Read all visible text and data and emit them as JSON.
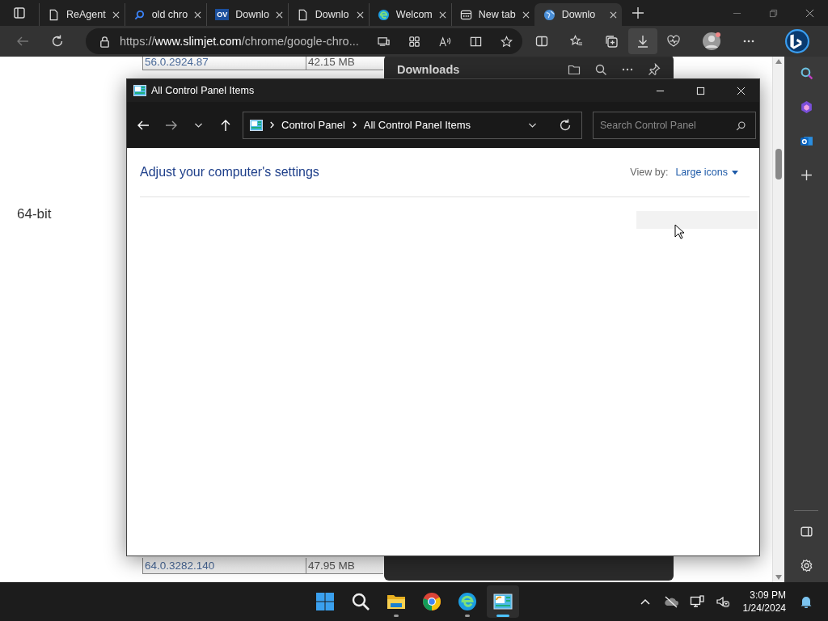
{
  "browser": {
    "tabs": [
      {
        "label": "ReAgent",
        "kind": "page",
        "selected": false
      },
      {
        "label": "old chro",
        "kind": "search",
        "selected": false
      },
      {
        "label": "Downlo",
        "kind": "badge",
        "icon_text": "OV",
        "selected": false
      },
      {
        "label": "Downlo",
        "kind": "page",
        "selected": false
      },
      {
        "label": "Welcom",
        "kind": "edge",
        "selected": false
      },
      {
        "label": "New tab",
        "kind": "newtab",
        "selected": false
      },
      {
        "label": "Downlo",
        "kind": "globe",
        "selected": true
      }
    ],
    "url": "https://**www.slimjet.com**/chrome/google-chro..."
  },
  "page": {
    "rows_top": [
      {
        "version": "56.0.2924.87",
        "size": "42.15 MB"
      }
    ],
    "label": "64-bit",
    "rows_bottom": [
      {
        "version": "64.0.3282.140",
        "size": "47.95 MB"
      }
    ]
  },
  "downloads": {
    "title": "Downloads"
  },
  "control_panel": {
    "title": "All Control Panel Items",
    "breadcrumbs": [
      "Control Panel",
      "All Control Panel Items"
    ],
    "search": {
      "placeholder": "Search Control Panel"
    },
    "heading": "Adjust your computer's settings",
    "view_by_label": "View by:",
    "view_by_value": "Large icons"
  },
  "taskbar": {
    "apps": [
      {
        "kind": "start",
        "running": false,
        "selected": false
      },
      {
        "kind": "search",
        "running": false,
        "selected": false
      },
      {
        "kind": "explorer",
        "running": true,
        "selected": false
      },
      {
        "kind": "chrome",
        "running": false,
        "selected": false
      },
      {
        "kind": "edge",
        "running": true,
        "selected": false
      },
      {
        "kind": "controlpanel",
        "running": true,
        "selected": true
      }
    ],
    "time": "3:09 PM",
    "date": "1/24/2024"
  }
}
